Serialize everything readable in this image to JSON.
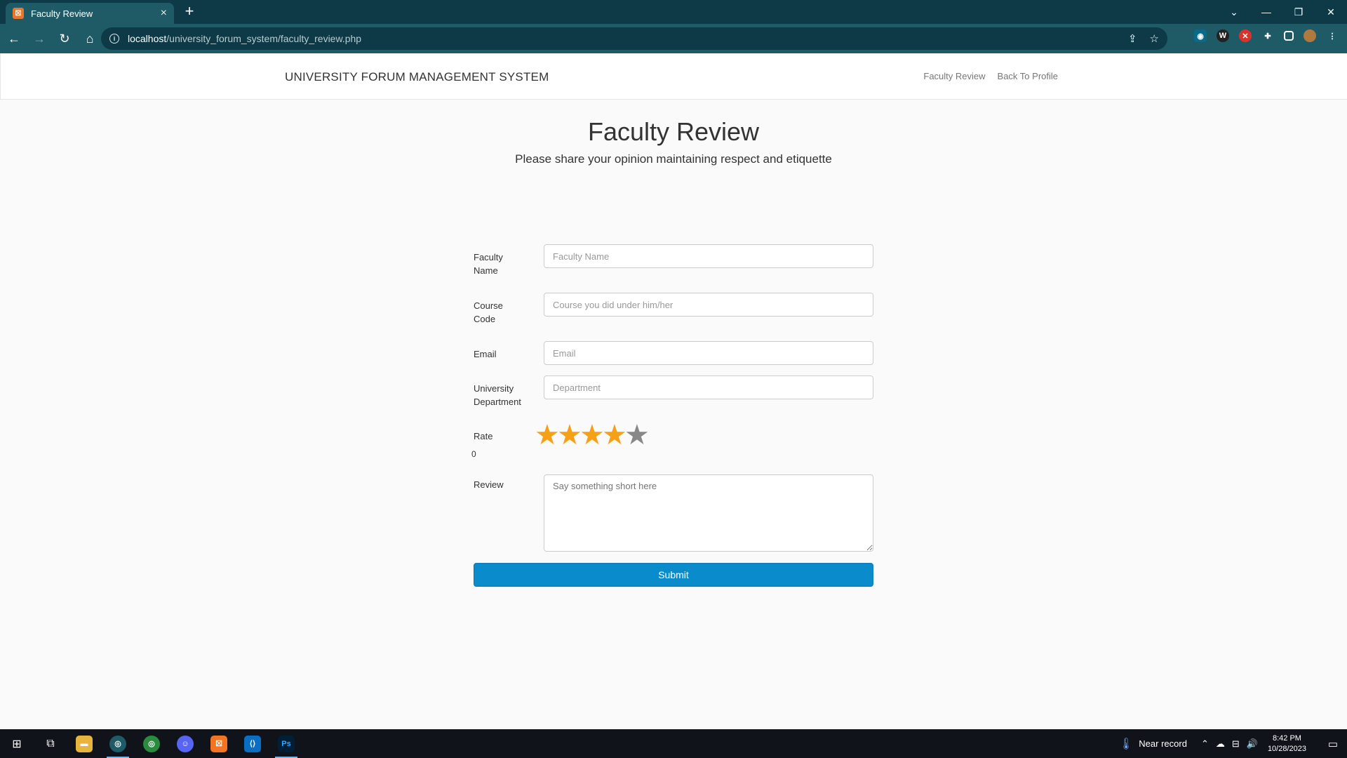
{
  "browser": {
    "tab_title": "Faculty Review",
    "url_host": "localhost",
    "url_path": "/university_forum_system/faculty_review.php",
    "new_tab_glyph": "+",
    "close_glyph": "×"
  },
  "site": {
    "brand": "UNIVERSITY FORUM MANAGEMENT SYSTEM",
    "nav": [
      "Faculty Review",
      "Back To Profile"
    ]
  },
  "header": {
    "title": "Faculty Review",
    "subtitle": "Please share your opinion maintaining respect and etiquette"
  },
  "form": {
    "faculty_label_1": "Faculty",
    "faculty_label_2": "Name",
    "faculty_placeholder": "Faculty Name",
    "course_label_1": "Course",
    "course_label_2": "Code",
    "course_placeholder": "Course you did under him/her",
    "email_label": "Email",
    "email_placeholder": "Email",
    "dept_label_1": "University",
    "dept_label_2": "Department",
    "dept_placeholder": "Department",
    "rate_label": "Rate",
    "rate_value": "0",
    "rating": {
      "filled": 4,
      "total": 5
    },
    "review_label": "Review",
    "review_placeholder": "Say something short here",
    "submit_label": "Submit"
  },
  "taskbar": {
    "weather": "Near record",
    "time": "8:42 PM",
    "date": "10/28/2023"
  },
  "colors": {
    "accent": "#0a8ccc",
    "star_on": "#f5a017",
    "star_off": "#888888",
    "chrome": "#1f5a67"
  }
}
